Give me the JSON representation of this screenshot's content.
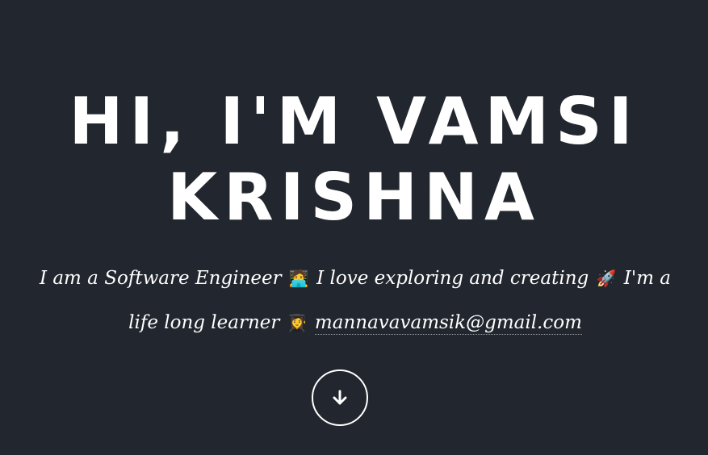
{
  "hero": {
    "title_line1": "HI, I'M VAMSI",
    "title_line2": "KRISHNA",
    "intro_part1": "I am a Software Engineer",
    "emoji1": "🧑‍💻",
    "intro_part2": "I love exploring and creating",
    "emoji2": "🚀",
    "intro_part3": "I'm a life long learner",
    "emoji3": "👩‍🎓",
    "email": "mannavavamsik@gmail.com",
    "scroll_icon": "arrow-down-icon"
  },
  "colors": {
    "background": "#22262e",
    "text": "#ffffff"
  }
}
